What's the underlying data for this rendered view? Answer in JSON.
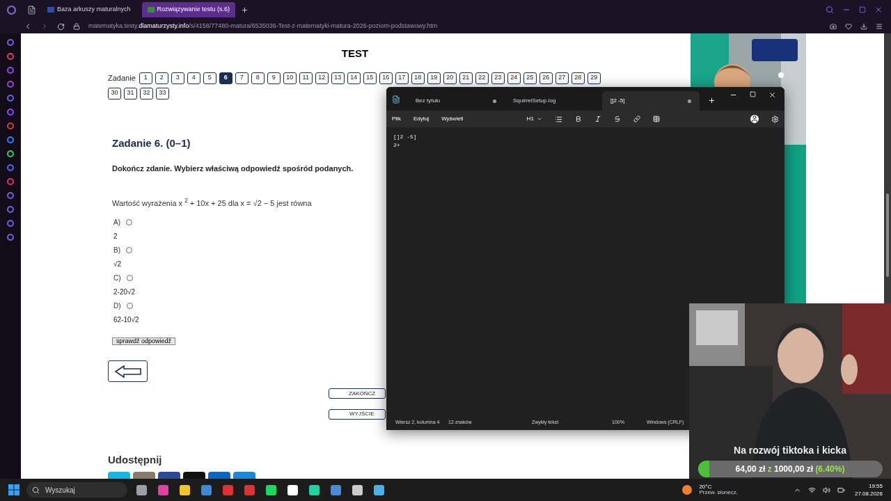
{
  "browser": {
    "tabs": [
      {
        "title": "Baza arkuszy maturalnych",
        "selected": false
      },
      {
        "title": "Rozwiązywanie testu (s.6)",
        "selected": true
      }
    ],
    "url_prefix": "matematyka.testy.",
    "url_host": "dlamaturzysty.info",
    "url_path": "/s/4158/77480-matura/6535036-Test-z-matematyki-matura-2026-poziom-podstawowy.htm"
  },
  "page": {
    "heading": "TEST",
    "nav_label": "Zadanie",
    "tasks": [
      {
        "label": "1",
        "selected": false
      },
      {
        "label": "2",
        "selected": false
      },
      {
        "label": "3",
        "selected": false
      },
      {
        "label": "4",
        "selected": false
      },
      {
        "label": "5",
        "selected": false
      },
      {
        "label": "6",
        "selected": true
      },
      {
        "label": "7",
        "selected": false
      },
      {
        "label": "8",
        "selected": false
      },
      {
        "label": "9",
        "selected": false
      },
      {
        "label": "10",
        "selected": false
      },
      {
        "label": "11",
        "selected": false
      },
      {
        "label": "12",
        "selected": false
      },
      {
        "label": "13",
        "selected": false
      },
      {
        "label": "14",
        "selected": false
      },
      {
        "label": "15",
        "selected": false
      },
      {
        "label": "16",
        "selected": false
      },
      {
        "label": "17",
        "selected": false
      },
      {
        "label": "18",
        "selected": false
      },
      {
        "label": "19",
        "selected": false
      },
      {
        "label": "20",
        "selected": false
      },
      {
        "label": "21",
        "selected": false
      },
      {
        "label": "22",
        "selected": false
      },
      {
        "label": "23",
        "selected": false
      },
      {
        "label": "24",
        "selected": false
      },
      {
        "label": "25",
        "selected": false
      },
      {
        "label": "26",
        "selected": false
      },
      {
        "label": "27",
        "selected": false
      },
      {
        "label": "28",
        "selected": false
      },
      {
        "label": "29",
        "selected": false
      },
      {
        "label": "30",
        "selected": false
      },
      {
        "label": "31",
        "selected": false
      },
      {
        "label": "32",
        "selected": false
      },
      {
        "label": "33",
        "selected": false
      }
    ],
    "task_title": "Zadanie 6. (0–1)",
    "instruction": "Dokończ zdanie. Wybierz właściwą odpowiedź spośród podanych.",
    "question": "Wartość wyrażenia x $^{2}$ + 10x + 25 dla x = √2 − 5 jest równa",
    "options": [
      {
        "letter": "A)",
        "value": "2",
        "selected": false
      },
      {
        "letter": "B)",
        "value": "√2",
        "selected": false
      },
      {
        "letter": "C)",
        "value": "2-20√2",
        "selected": false
      },
      {
        "letter": "D)",
        "value": "62-10√2",
        "selected": false
      }
    ],
    "check_button": "sprawdź odpowiedź",
    "end_button": "ZAKOŃCZ",
    "exit_button": "WYJŚCIE",
    "share_heading": "Udostępnij"
  },
  "notepad": {
    "tabs": [
      {
        "title": "Bez tytułu",
        "selected": false,
        "unsaved": true
      },
      {
        "title": "SquirrelSetup.log",
        "selected": false,
        "unsaved": false
      },
      {
        "title": "[]2 -5]",
        "selected": true,
        "unsaved": true
      }
    ],
    "menu": [
      "Plik",
      "Edytuj",
      "Wyświetl"
    ],
    "heading_select": "H1",
    "lines": [
      "[]2 -5]",
      "2+"
    ],
    "status": [
      "Wiersz 2, kolumna 4",
      "12 znaków",
      "Zwykły tekst",
      "100%",
      "Windows (CRLF)"
    ]
  },
  "stream": {
    "goal_title": "Na rozwój tiktoka i kicka",
    "amount": "64,00 zł",
    "of": "z",
    "goal": "1000,00 zł",
    "percent": "(6.40%)",
    "level": 0.064
  },
  "taskbar": {
    "search_placeholder": "Wyszukaj",
    "weather_temp": "20°C",
    "weather_text": "Przew. słonecz.",
    "time": "19:55",
    "date": "27.08.2026"
  }
}
